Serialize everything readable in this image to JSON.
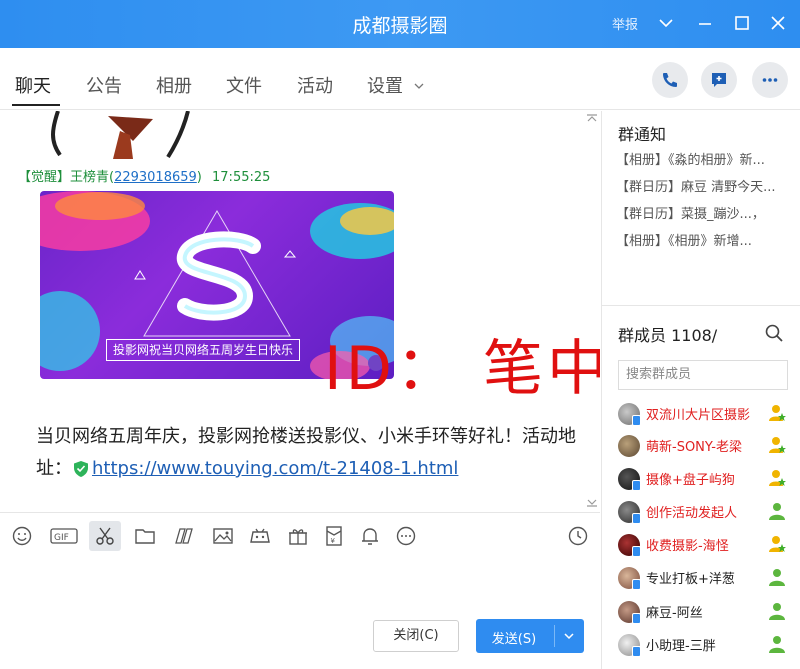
{
  "window": {
    "title": "成都摄影圈",
    "report_label": "举报"
  },
  "tabs": [
    {
      "label": "聊天"
    },
    {
      "label": "公告"
    },
    {
      "label": "相册"
    },
    {
      "label": "文件"
    },
    {
      "label": "活动"
    },
    {
      "label": "设置"
    }
  ],
  "chat": {
    "sender_prefix": "【觉醒】王榜青(",
    "sender_qq": "2293018659",
    "sender_suffix": ")",
    "time": "17:55:25",
    "banner_caption": "投影网祝当贝网络五周岁生日快乐",
    "message_text": "当贝网络五周年庆，投影网抢楼送投影仪、小米手环等好礼！活动地址：",
    "message_link": "https://www.touying.com/t-21408-1.html",
    "watermark": "ID：  笔中求生"
  },
  "actions": {
    "close_label": "关闭(C)",
    "send_label": "发送(S)"
  },
  "notice": {
    "title": "群通知",
    "items": [
      "【相册】《淼的相册》新...",
      "【群日历】麻豆 清野今天...",
      "【群日历】菜摄_蹦沙...，",
      "【相册】《相册》新增..."
    ]
  },
  "members": {
    "title": "群成员 1108/",
    "search_placeholder": "搜索群成员",
    "list": [
      {
        "name": "双流川大片区摄影",
        "color": "#e02020",
        "role": "star"
      },
      {
        "name": "萌新-SONY-老梁",
        "color": "#e02020",
        "role": "star"
      },
      {
        "name": "摄像+盘子屿狗",
        "color": "#e02020",
        "role": "star"
      },
      {
        "name": "创作活动发起人",
        "color": "#e02020",
        "role": "person"
      },
      {
        "name": "收费摄影-海怪",
        "color": "#e02020",
        "role": "star"
      },
      {
        "name": "专业打板+洋葱",
        "color": "#222222",
        "role": "person"
      },
      {
        "name": "麻豆-阿丝",
        "color": "#222222",
        "role": "person"
      },
      {
        "name": "小助理-三胖",
        "color": "#222222",
        "role": "person"
      }
    ]
  },
  "colors": {
    "titlebar": "#2e8ef0",
    "accent": "#2f8cf0",
    "watermark": "#e01010",
    "sender": "#1e8f3b"
  }
}
